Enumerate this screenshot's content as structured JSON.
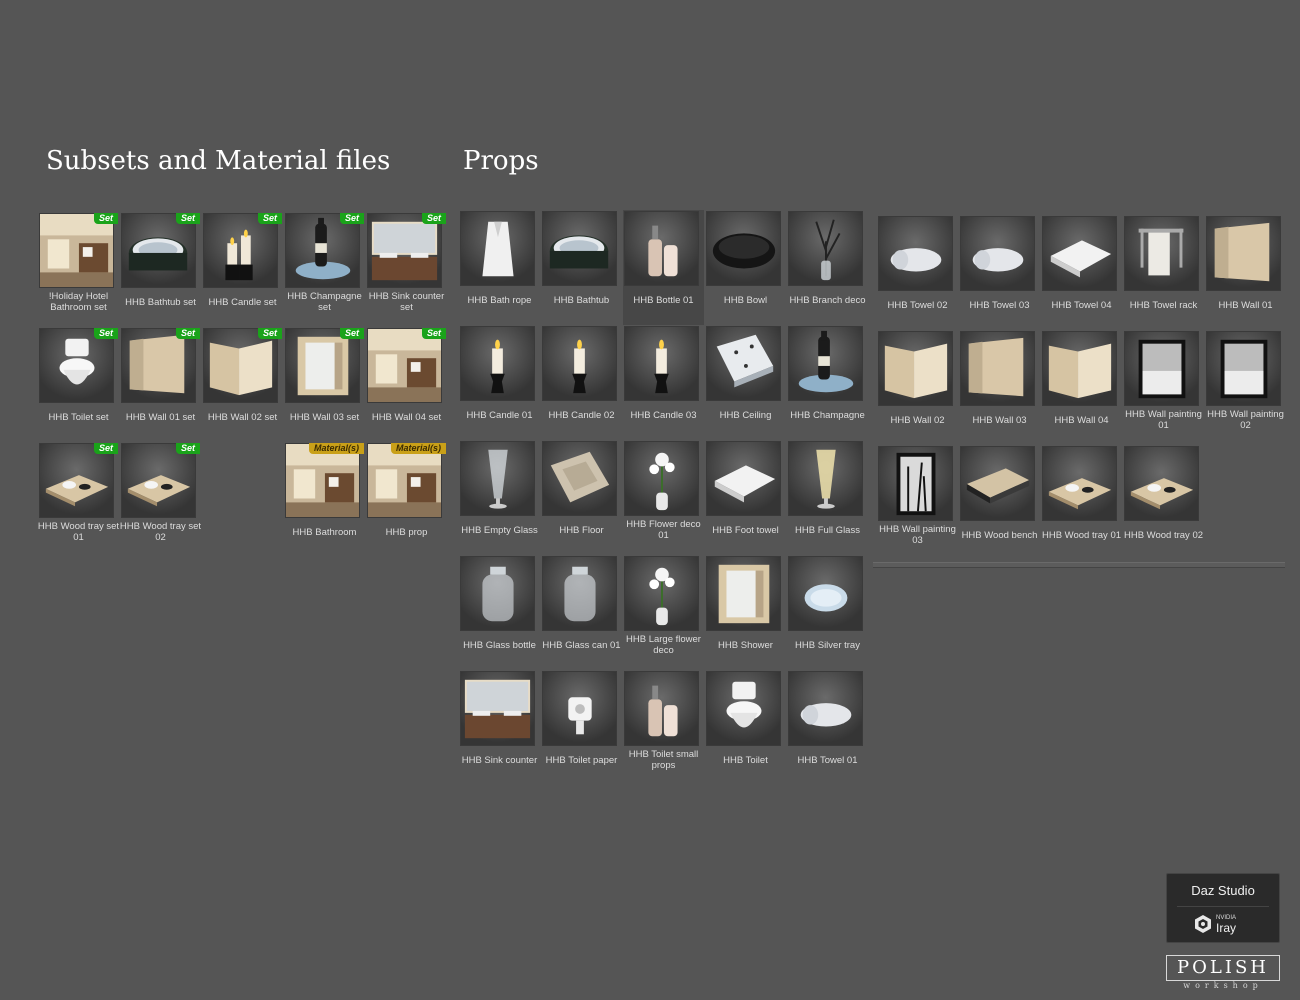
{
  "headings": {
    "subsets": "Subsets and Material files",
    "props": "Props"
  },
  "subsets": [
    {
      "label": "!Holiday Hotel Bathroom set",
      "badge": "Set",
      "icon": "room"
    },
    {
      "label": "HHB Bathtub set",
      "badge": "Set",
      "icon": "bathtub"
    },
    {
      "label": "HHB Candle set",
      "badge": "Set",
      "icon": "candles"
    },
    {
      "label": "HHB Champagne set",
      "badge": "Set",
      "icon": "champagne"
    },
    {
      "label": "HHB Sink counter set",
      "badge": "Set",
      "icon": "sink"
    },
    {
      "label": "HHB Toilet set",
      "badge": "Set",
      "icon": "toilet"
    },
    {
      "label": "HHB Wall 01 set",
      "badge": "Set",
      "icon": "wall"
    },
    {
      "label": "HHB Wall 02 set",
      "badge": "Set",
      "icon": "wall-corner"
    },
    {
      "label": "HHB Wall 03 set",
      "badge": "Set",
      "icon": "shower"
    },
    {
      "label": "HHB Wall 04 set",
      "badge": "Set",
      "icon": "room"
    },
    {
      "label": "HHB Wood tray set 01",
      "badge": "Set",
      "icon": "tray"
    },
    {
      "label": "HHB Wood tray set 02",
      "badge": "Set",
      "icon": "tray"
    },
    {
      "spacer": true
    },
    {
      "label": "HHB Bathroom",
      "badge": "Material(s)",
      "icon": "room"
    },
    {
      "label": "HHB prop",
      "badge": "Material(s)",
      "icon": "room"
    }
  ],
  "props_left": [
    {
      "label": "HHB Bath rope",
      "icon": "robe"
    },
    {
      "label": "HHB Bathtub",
      "icon": "bathtub"
    },
    {
      "label": "HHB Bottle 01",
      "icon": "bottle",
      "selected": true
    },
    {
      "label": "HHB Bowl",
      "icon": "bowl"
    },
    {
      "label": "HHB Branch deco",
      "icon": "branch"
    },
    {
      "label": "HHB Candle 01",
      "icon": "candle"
    },
    {
      "label": "HHB Candle 02",
      "icon": "candle"
    },
    {
      "label": "HHB Candle 03",
      "icon": "candle"
    },
    {
      "label": "HHB Ceiling",
      "icon": "ceiling"
    },
    {
      "label": "HHB Champagne",
      "icon": "champagne"
    },
    {
      "label": "HHB Empty Glass",
      "icon": "glass"
    },
    {
      "label": "HHB Floor",
      "icon": "floor"
    },
    {
      "label": "HHB Flower deco 01",
      "icon": "flower"
    },
    {
      "label": "HHB Foot towel",
      "icon": "towel-flat"
    },
    {
      "label": "HHB Full Glass",
      "icon": "glass-full"
    },
    {
      "label": "HHB Glass bottle",
      "icon": "jar"
    },
    {
      "label": "HHB Glass can 01",
      "icon": "jar"
    },
    {
      "label": "HHB Large flower deco",
      "icon": "flower"
    },
    {
      "label": "HHB Shower",
      "icon": "shower"
    },
    {
      "label": "HHB Silver tray",
      "icon": "plate"
    },
    {
      "label": "HHB Sink counter",
      "icon": "sink"
    },
    {
      "label": "HHB Toilet paper",
      "icon": "paper"
    },
    {
      "label": "HHB Toilet small props",
      "icon": "bottle"
    },
    {
      "label": "HHB Toilet",
      "icon": "toilet"
    },
    {
      "label": "HHB Towel 01",
      "icon": "towel-roll"
    }
  ],
  "props_right": [
    {
      "label": "HHB Towel 02",
      "icon": "towel-roll"
    },
    {
      "label": "HHB Towel 03",
      "icon": "towel-roll"
    },
    {
      "label": "HHB Towel 04",
      "icon": "towel-flat"
    },
    {
      "label": "HHB Towel rack",
      "icon": "rack"
    },
    {
      "label": "HHB Wall 01",
      "icon": "wall"
    },
    {
      "label": "HHB Wall 02",
      "icon": "wall-corner"
    },
    {
      "label": "HHB Wall 03",
      "icon": "wall"
    },
    {
      "label": "HHB Wall 04",
      "icon": "wall-corner"
    },
    {
      "label": "HHB Wall painting 01",
      "icon": "painting"
    },
    {
      "label": "HHB Wall painting 02",
      "icon": "painting"
    },
    {
      "label": "HHB Wall painting 03",
      "icon": "painting-tall"
    },
    {
      "label": "HHB Wood bench",
      "icon": "bench"
    },
    {
      "label": "HHB Wood tray 01",
      "icon": "tray"
    },
    {
      "label": "HHB Wood tray 02",
      "icon": "tray"
    }
  ],
  "branding": {
    "daz": "Daz Studio",
    "nvidia": "NVIDIA",
    "iray": "Iray",
    "polish": "POLISH",
    "workshop": "workshop"
  },
  "colors": {
    "background": "#555555",
    "set_badge": "#1aa31a",
    "material_badge": "#c9a018"
  }
}
